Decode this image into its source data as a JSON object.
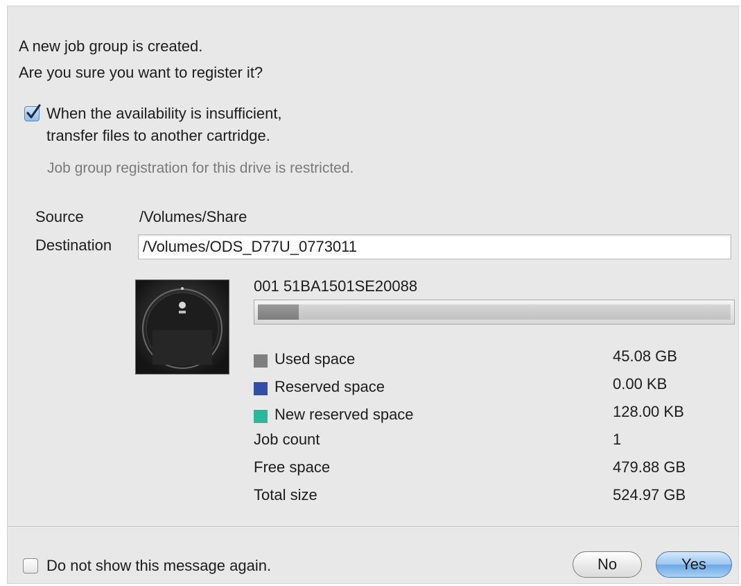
{
  "message": {
    "line1": "A new job group is created.",
    "line2": "Are you sure you want to register it?"
  },
  "transfer_option": {
    "checked": true,
    "line1": "When the availability is insufficient,",
    "line2": "transfer files to another cartridge."
  },
  "restriction_note": "Job group registration for this drive is restricted.",
  "source": {
    "label": "Source",
    "value": "/Volumes/Share"
  },
  "destination": {
    "label": "Destination",
    "value": "/Volumes/ODS_D77U_0773011"
  },
  "cartridge": {
    "icon": "optical-disc-cartridge-icon",
    "id": "001 51BA1501SE20088",
    "used_fraction": 0.0859,
    "legend": [
      {
        "label": "Used space",
        "value": "45.08 GB",
        "swatch": "#7f7f7f"
      },
      {
        "label": "Reserved space",
        "value": "0.00 KB",
        "swatch": "#2f4ea8"
      },
      {
        "label": "New reserved space",
        "value": "128.00 KB",
        "swatch": "#2bb89a"
      }
    ],
    "stats": [
      {
        "label": "Job count",
        "value": "1"
      },
      {
        "label": "Free space",
        "value": "479.88 GB"
      },
      {
        "label": "Total size",
        "value": "524.97 GB"
      }
    ]
  },
  "dont_show": {
    "checked": false,
    "label": "Do not show this message again."
  },
  "buttons": {
    "no": "No",
    "yes": "Yes"
  }
}
